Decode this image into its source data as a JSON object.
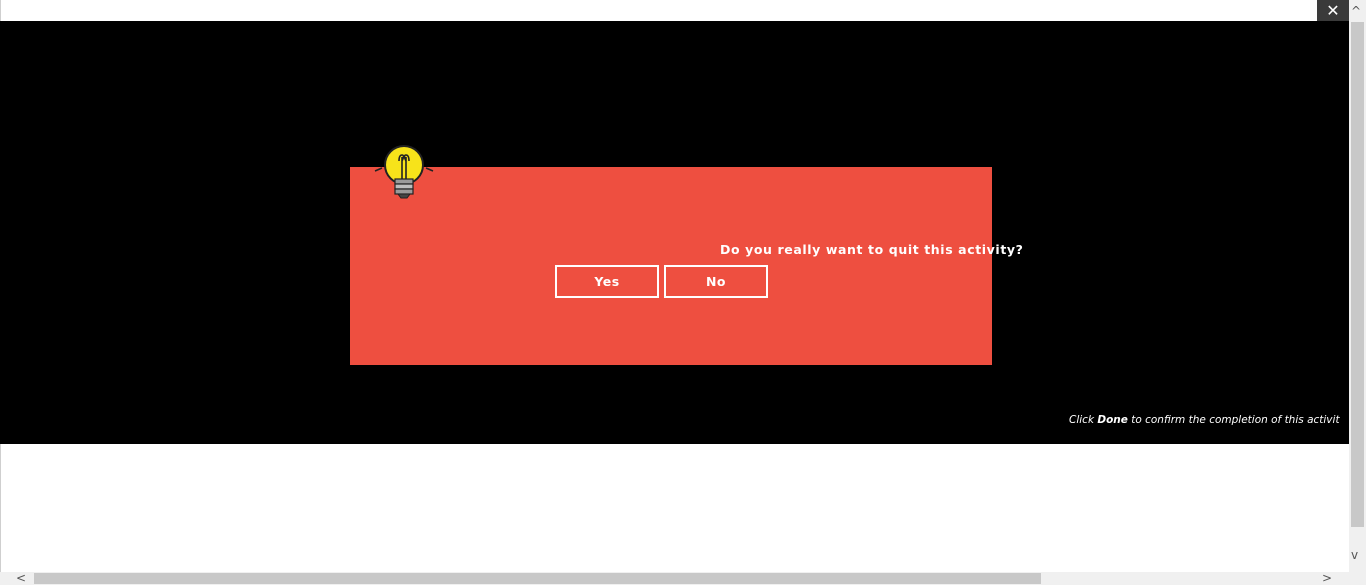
{
  "window": {
    "close_glyph": "✕"
  },
  "dialog": {
    "question": "Do you really want to quit this activity?",
    "yes_label": "Yes",
    "no_label": "No",
    "background_color": "#ee4f40",
    "icon": "lightbulb-icon"
  },
  "footer": {
    "prefix": "Click ",
    "emphasis": "Done",
    "suffix": " to confirm the completion of this activit"
  },
  "scrollbars": {
    "up_arrow": "^",
    "down_arrow": "v",
    "left_arrow": "<",
    "right_arrow": ">"
  }
}
